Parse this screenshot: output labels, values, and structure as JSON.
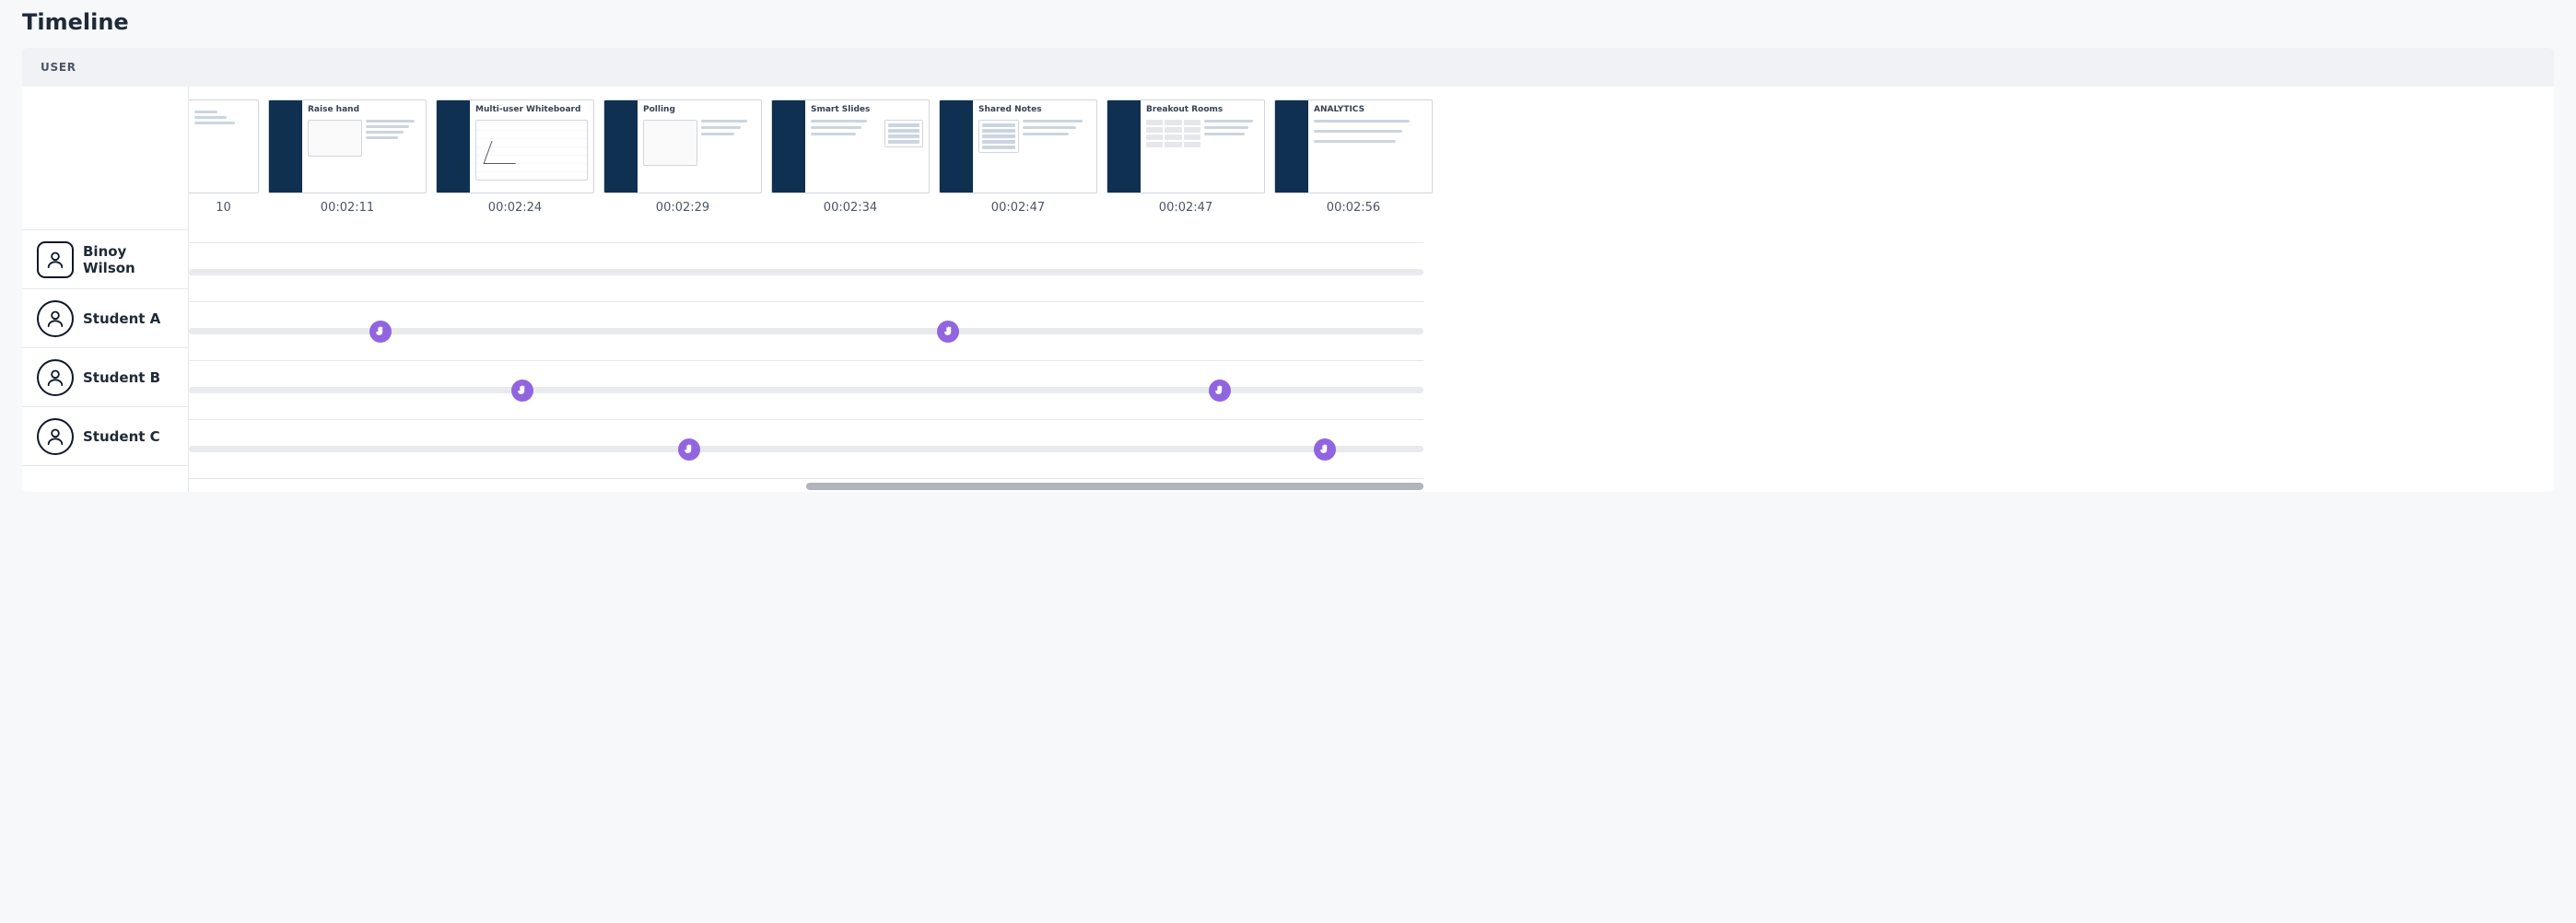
{
  "title": "Timeline",
  "header_col": "USER",
  "colors": {
    "accent": "#9165e0",
    "navy": "#0f3050"
  },
  "slides": [
    {
      "title": "",
      "timestamp": "10"
    },
    {
      "title": "Raise hand",
      "timestamp": "00:02:11"
    },
    {
      "title": "Multi-user Whiteboard",
      "timestamp": "00:02:24"
    },
    {
      "title": "Polling",
      "timestamp": "00:02:29"
    },
    {
      "title": "Smart Slides",
      "timestamp": "00:02:34"
    },
    {
      "title": "Shared Notes",
      "timestamp": "00:02:47"
    },
    {
      "title": "Breakout Rooms",
      "timestamp": "00:02:47"
    },
    {
      "title": "ANALYTICS",
      "timestamp": "00:02:56"
    }
  ],
  "users": [
    {
      "name": "Binoy Wilson",
      "avatar_shape": "square",
      "markers": []
    },
    {
      "name": "Student A",
      "avatar_shape": "round",
      "markers": [
        15.5,
        61.5
      ]
    },
    {
      "name": "Student B",
      "avatar_shape": "round",
      "markers": [
        27.0,
        83.5
      ]
    },
    {
      "name": "Student C",
      "avatar_shape": "round",
      "markers": [
        40.5,
        92.0
      ]
    }
  ],
  "marker_icon": "raise-hand-icon",
  "scrollbar": {
    "thumb_start_pct": 50,
    "thumb_end_pct": 100
  }
}
